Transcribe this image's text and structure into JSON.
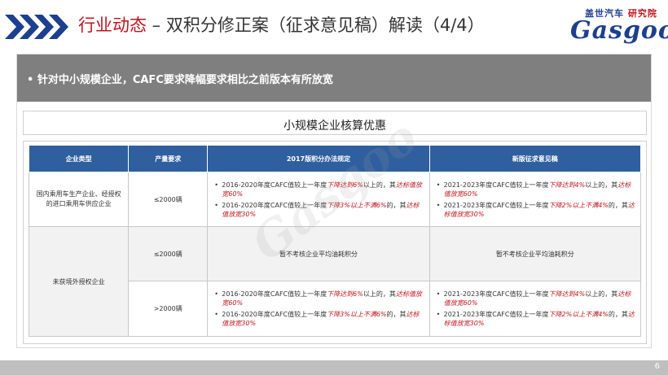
{
  "header": {
    "title_accent": "行业动态",
    "title_sep": " – ",
    "title_main": "双积分修正案（征求意见稿）解读（4/4）"
  },
  "logo": {
    "sub_blue": "盖世汽车",
    "sub_red": "研究院",
    "main": "Gasgoo"
  },
  "banner": {
    "text": "•  针对中小规模企业，CAFC要求降幅要求相比之前版本有所放宽"
  },
  "subtitle": "小规模企业核算优惠",
  "table": {
    "headers": [
      "企业类型",
      "产量要求",
      "2017版积分办法规定",
      "新版征求意见稿"
    ],
    "row1": {
      "type": "国内乘用车生产企业、经授权的进口乘用车供应企业",
      "volume": "≤2000辆",
      "old": [
        {
          "pre": "2016-2020年度CAFC值较上一年度",
          "hl1": "下降达到6%",
          "mid": "以上的，其",
          "hl2": "达标值放宽60%"
        },
        {
          "pre": "2016-2020年度CAFC值较上一年度",
          "hl1": "下降3%以上不满6%",
          "mid": "的，其",
          "hl2": "达标值放宽30%"
        }
      ],
      "new": [
        {
          "pre": "2021-2023年度CAFC值较上一年度",
          "hl1": "下降达到4%",
          "mid": "以上的，其",
          "hl2": "达标值放宽60%"
        },
        {
          "pre": "2021-2023年度CAFC值较上一年度",
          "hl1": "下降2%以上不满4%",
          "mid": "的，其",
          "hl2": "达标值放宽30%"
        }
      ]
    },
    "row2": {
      "type": "未获境外授权企业",
      "volume": "≤2000辆",
      "old": "暂不考核企业平均油耗积分",
      "new": "暂不考核企业平均油耗积分"
    },
    "row3": {
      "volume": ">2000辆",
      "old": [
        {
          "pre": "2016-2020年度CAFC值较上一年度",
          "hl1": "下降达到6%",
          "mid": "以上的，其",
          "hl2": "达标值放宽60%"
        },
        {
          "pre": "2016-2020年度CAFC值较上一年度",
          "hl1": "下降3%以上不满6%",
          "mid": "的，其",
          "hl2": "达标值放宽30%"
        }
      ],
      "new": [
        {
          "pre": "2021-2023年度CAFC值较上一年度",
          "hl1": "下降达到4%",
          "mid": "以上的，其",
          "hl2": "达标值放宽60%"
        },
        {
          "pre": "2021-2023年度CAFC值较上一年度",
          "hl1": "下降2%以上不满4%",
          "mid": "的，其",
          "hl2": "达标值放宽30%"
        }
      ]
    }
  },
  "watermark": "Gasgoo",
  "page_number": "6",
  "colors": {
    "accent_red": "#c0161c",
    "header_blue": "#2f5f9e",
    "banner_grey": "#7f7f7f"
  }
}
